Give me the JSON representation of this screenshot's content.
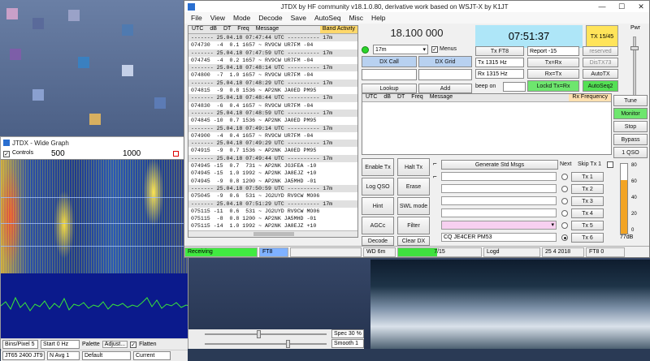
{
  "main_window": {
    "title": "JTDX  by HF community                                v18.1.0.80, derivative work based on WSJT-X by K1JT",
    "menu": [
      "File",
      "View",
      "Mode",
      "Decode",
      "Save",
      "AutoSeq",
      "Misc",
      "Help"
    ]
  },
  "band_activity": {
    "header": [
      "UTC",
      "dB",
      "DT",
      "Freq",
      "Message"
    ],
    "tag": "Band Activity",
    "rows": [
      {
        "t": "------- 25.04.18 07:47:44 UTC ---------- 17m",
        "sep": true
      },
      {
        "t": "074730  -4  0.1 1657 ~ RV9CW UR7FM -04",
        "sep": false
      },
      {
        "t": "------- 25.04.18 07:47:59 UTC ---------- 17m",
        "sep": true
      },
      {
        "t": "074745  -4  0.2 1657 ~ RV9CW UR7FM -04",
        "sep": false
      },
      {
        "t": "------- 25.04.18 07:48:14 UTC ---------- 17m",
        "sep": true
      },
      {
        "t": "074800  -7  1.0 1657 ~ RV9CW UR7FM -04",
        "sep": false
      },
      {
        "t": "------- 25.04.18 07:48:29 UTC ---------- 17m",
        "sep": true
      },
      {
        "t": "074815  -9  0.8 1536 ~ AP2NK JA0ED PM95",
        "sep": false
      },
      {
        "t": "------- 25.04.18 07:48:44 UTC ---------- 17m",
        "sep": true
      },
      {
        "t": "074830  -6  0.4 1657 ~ RV9CW UR7FM -04",
        "sep": false
      },
      {
        "t": "------- 25.04.18 07:48:59 UTC ---------- 17m",
        "sep": true
      },
      {
        "t": "074845 -10  0.7 1536 ~ AP2NK JA0ED PM95",
        "sep": false
      },
      {
        "t": "------- 25.04.18 07:49:14 UTC ---------- 17m",
        "sep": true
      },
      {
        "t": "074900  -4  0.4 1657 ~ RV9CW UR7FM -04",
        "sep": false
      },
      {
        "t": "------- 25.04.18 07:49:29 UTC ---------- 17m",
        "sep": true
      },
      {
        "t": "074915  -9  0.7 1536 ~ AP2NK JA0ED PM95",
        "sep": false
      },
      {
        "t": "------- 25.04.18 07:49:44 UTC ---------- 17m",
        "sep": true
      },
      {
        "t": "074945 -15  0.7  731 ~ AP2NK JG3FEA -10",
        "sep": false
      },
      {
        "t": "074945 -15  1.0 1992 ~ AP2NK JA8EJZ +10",
        "sep": false
      },
      {
        "t": "074945  -9  0.8 1200 ~ AP2NK JA5MHD -01",
        "sep": false
      },
      {
        "t": "------- 25.04.18 07:50:59 UTC ---------- 17m",
        "sep": true
      },
      {
        "t": "075045  -9  0.6  531 ~ JG2UYD RV9CW MO06",
        "sep": false
      },
      {
        "t": "------- 25.04.18 07:51:29 UTC ---------- 17m",
        "sep": true
      },
      {
        "t": "075115 -11  0.6  531 ~ JG2UYD RV9CW MO06",
        "sep": false
      },
      {
        "t": "075115  -8  0.8 1200 ~ AP2NK JA5MHD -01",
        "sep": false
      },
      {
        "t": "075115 -14  1.0 1992 ~ AP2NK JA8EJZ +10",
        "sep": false
      }
    ]
  },
  "controls": {
    "frequency": "18.100 000",
    "clock": "07:51:37",
    "tx_badge": "TX 15/45",
    "pwr": "Pwr",
    "band": "17m",
    "menus": "Menus",
    "dx_call": "DX Call",
    "dx_grid": "DX Grid",
    "lookup": "Lookup",
    "add": "Add",
    "tx_ft8": "Tx  FT8",
    "report": "Report -15",
    "reserved": "reserved",
    "tx_hz": "Tx  1315  Hz",
    "rx_hz": "Rx  1315  Hz",
    "tx_eq_rx": "Tx=Rx",
    "dis_tx73": "DisTX73",
    "rx_eq_tx": "Rx=Tx",
    "autotx": "AutoTX",
    "beep_on": "beep on",
    "lockd": "Lockd Tx=Rx",
    "autoseq2": "AutoSeq2"
  },
  "rx_frequency": {
    "header": [
      "UTC",
      "dB",
      "DT",
      "Freq",
      "Message"
    ],
    "tag": "Rx Frequency"
  },
  "side_buttons": [
    "Tune",
    "Monitor",
    "Stop",
    "Bypass",
    "1 QSO"
  ],
  "action_buttons": {
    "enable_tx": "Enable Tx",
    "halt_tx": "Halt Tx",
    "log_qso": "Log QSO",
    "erase": "Erase",
    "hint": "Hint",
    "swl_mode": "SWL mode",
    "agcc": "AGCc",
    "filter": "Filter",
    "decode": "Decode",
    "clear_dx": "Clear DX"
  },
  "messages": {
    "generate": "Generate Std Msgs",
    "next": "Next",
    "skip_tx1": "Skip Tx 1",
    "tx_labels": [
      "Tx 1",
      "Tx 2",
      "Tx 3",
      "Tx 4",
      "Tx 5",
      "Tx 6"
    ],
    "tx6_text": "CQ JE4CER PM53"
  },
  "meter": {
    "labels": [
      "80",
      "60",
      "40",
      "20",
      "0"
    ],
    "readout": "77dB",
    "level_percent": 77
  },
  "status": {
    "receiving": "Receiving",
    "mode": "FT8",
    "wd": "WD 6m",
    "progress": "7/15",
    "logd": "Logd",
    "date": "25 4 2018",
    "ft8_0": "FT8  0"
  },
  "wide_graph": {
    "title": "JTDX - Wide Graph",
    "controls_label": "Controls",
    "scale": [
      "500",
      "1000"
    ],
    "bins": "Bins/Pixel  5",
    "start": "Start 0 Hz",
    "palette": "Palette",
    "adjust": "Adjust...",
    "flatten": "Flatten",
    "spec": "Spec  30 %",
    "jt65": "JT65  2400  JT9",
    "navg": "N Avg  1",
    "default": "Default",
    "current": "Current",
    "smooth": "Smooth  1"
  }
}
